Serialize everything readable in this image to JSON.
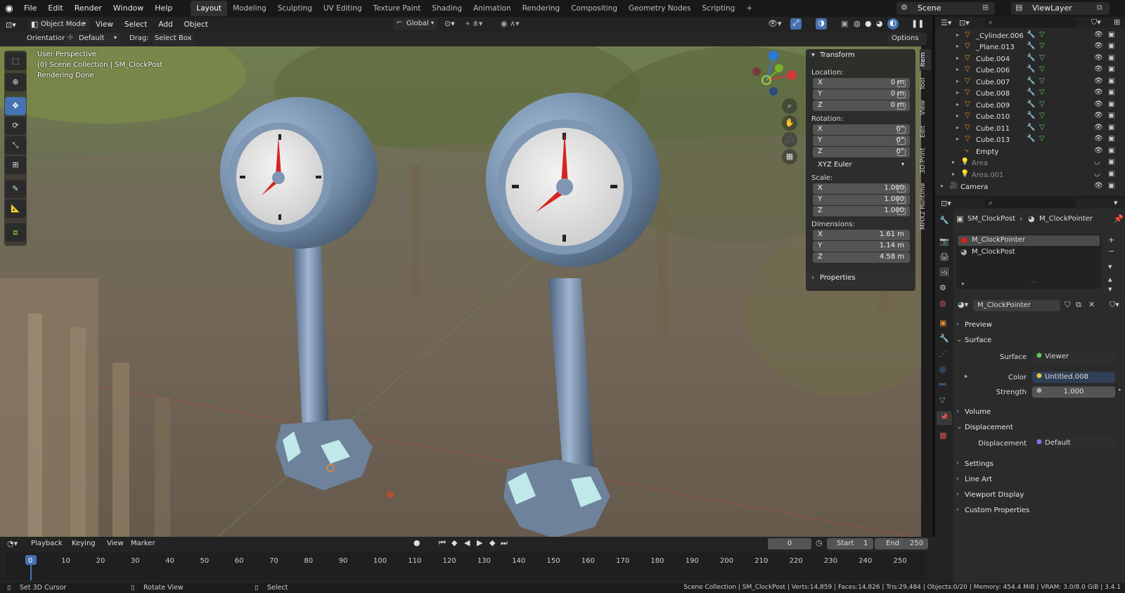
{
  "topbar": {
    "menus": [
      "File",
      "Edit",
      "Render",
      "Window",
      "Help"
    ],
    "workspaces": [
      "Layout",
      "Modeling",
      "Sculpting",
      "UV Editing",
      "Texture Paint",
      "Shading",
      "Animation",
      "Rendering",
      "Compositing",
      "Geometry Nodes",
      "Scripting"
    ],
    "active_workspace": "Layout",
    "add_tab": "+",
    "scene": "Scene",
    "view_layer": "ViewLayer"
  },
  "viewport_header": {
    "mode": "Object Mode",
    "menus": [
      "View",
      "Select",
      "Add",
      "Object"
    ],
    "transform_orientation": "Global",
    "orientation_label": "Orientation:",
    "orientation_value": "Default",
    "drag_label": "Drag:",
    "drag_value": "Select Box",
    "options": "Options"
  },
  "viewport_overlay": {
    "line1": "User Perspective",
    "line2": "(0) Scene Collection | SM_ClockPost",
    "line3": "Rendering Done"
  },
  "npanel": {
    "title": "Transform",
    "location_label": "Location:",
    "location": [
      {
        "axis": "X",
        "value": "0 m"
      },
      {
        "axis": "Y",
        "value": "0 m"
      },
      {
        "axis": "Z",
        "value": "0 m"
      }
    ],
    "rotation_label": "Rotation:",
    "rotation": [
      {
        "axis": "X",
        "value": "0°"
      },
      {
        "axis": "Y",
        "value": "0°"
      },
      {
        "axis": "Z",
        "value": "0°"
      }
    ],
    "rotation_mode": "XYZ Euler",
    "scale_label": "Scale:",
    "scale": [
      {
        "axis": "X",
        "value": "1.000"
      },
      {
        "axis": "Y",
        "value": "1.000"
      },
      {
        "axis": "Z",
        "value": "1.000"
      }
    ],
    "dimensions_label": "Dimensions:",
    "dimensions": [
      {
        "axis": "X",
        "value": "1.61 m"
      },
      {
        "axis": "Y",
        "value": "1.14 m"
      },
      {
        "axis": "Z",
        "value": "4.58 m"
      }
    ],
    "properties": "Properties",
    "tabs": [
      "Item",
      "Tool",
      "View",
      "Edit",
      "3D-Print",
      "MHX2 Runtime"
    ]
  },
  "outliner": {
    "items": [
      "_Cylinder.006",
      "_Plane.013",
      "Cube.004",
      "Cube.006",
      "Cube.007",
      "Cube.008",
      "Cube.009",
      "Cube.010",
      "Cube.011",
      "Cube.013",
      "Empty",
      "Area",
      "Area.001",
      "Camera"
    ]
  },
  "properties": {
    "object": "SM_ClockPost",
    "material": "M_ClockPointer",
    "slots": [
      "M_ClockPointer",
      "M_ClockPost"
    ],
    "material_field": "M_ClockPointer",
    "sections": {
      "preview": "Preview",
      "surface": "Surface",
      "volume": "Volume",
      "displacement": "Displacement",
      "settings": "Settings",
      "line_art": "Line Art",
      "viewport_display": "Viewport Display",
      "custom_properties": "Custom Properties"
    },
    "surface_label": "Surface",
    "surface_value": "Viewer",
    "color_label": "Color",
    "color_value": "Untitled.008",
    "strength_label": "Strength",
    "strength_value": "1.000",
    "displacement_label": "Displacement",
    "displacement_value": "Default"
  },
  "timeline": {
    "menus": [
      "Playback",
      "Keying",
      "View",
      "Marker"
    ],
    "current_frame": "0",
    "start_label": "Start",
    "start": "1",
    "end_label": "End",
    "end": "250",
    "ticks": [
      "0",
      "10",
      "20",
      "30",
      "40",
      "50",
      "60",
      "70",
      "80",
      "90",
      "100",
      "110",
      "120",
      "130",
      "140",
      "150",
      "160",
      "170",
      "180",
      "190",
      "200",
      "210",
      "220",
      "230",
      "240",
      "250"
    ]
  },
  "status": {
    "left1": "Set 3D Cursor",
    "left2": "Rotate View",
    "left3": "Select",
    "right": "Scene Collection | SM_ClockPost | Verts:14,859 | Faces:14,826 | Tris:29,484 | Objects:0/20 | Memory: 454.4 MiB | VRAM: 3.0/8.0 GiB | 3.4.1"
  },
  "colors": {
    "accent": "#4772b3",
    "post": "#6f8aa6",
    "hand": "#d8241f",
    "glass": "#bfe8e8"
  }
}
